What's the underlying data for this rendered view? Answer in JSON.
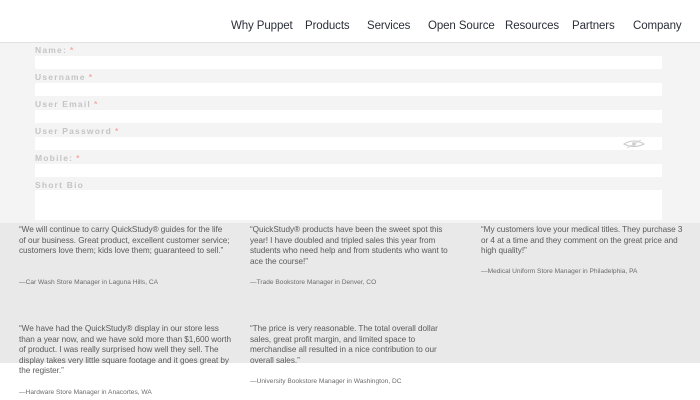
{
  "nav": {
    "items": [
      "Why Puppet",
      "Products",
      "Services",
      "Open Source",
      "Resources",
      "Partners",
      "Company"
    ]
  },
  "form": {
    "fields": [
      {
        "label": "Name:",
        "required": true
      },
      {
        "label": "Username",
        "required": true
      },
      {
        "label": "User Email",
        "required": true
      },
      {
        "label": "User Password",
        "required": true
      },
      {
        "label": "Mobile:",
        "required": true
      },
      {
        "label": "Short Bio",
        "required": false
      }
    ],
    "required_marker": "*"
  },
  "testimonials": [
    {
      "quote": "“We will continue to carry QuickStudy® guides for the life of our business. Great product, excellent customer service; customers love them; kids love them; guaranteed to sell.”",
      "attribution": "—Car Wash Store Manager in Laguna Hills, CA"
    },
    {
      "quote": "“QuickStudy® products have been the sweet spot this year! I have doubled and tripled sales this year from students who need help and from students who want to ace the course!”",
      "attribution": "—Trade Bookstore Manager in Denver, CO"
    },
    {
      "quote": "“My customers love your medical titles. They purchase 3 or 4 at a time and they comment on the great price and high quality!”",
      "attribution": "—Medical Uniform Store Manager in Philadelphia, PA"
    },
    {
      "quote": "“We have had the QuickStudy® display in our store less than a year now, and we have sold more than $1,600 worth of product. I was really surprised how well they sell. The display takes very little square footage and it goes great by the register.”",
      "attribution": "—Hardware Store Manager in Anacortes, WA"
    },
    {
      "quote": "“The price is very reasonable. The total overall dollar sales, great profit margin, and limited space to merchandise all resulted in a nice contribution to our overall sales.”",
      "attribution": "—University Bookstore Manager in Washington, DC"
    }
  ]
}
